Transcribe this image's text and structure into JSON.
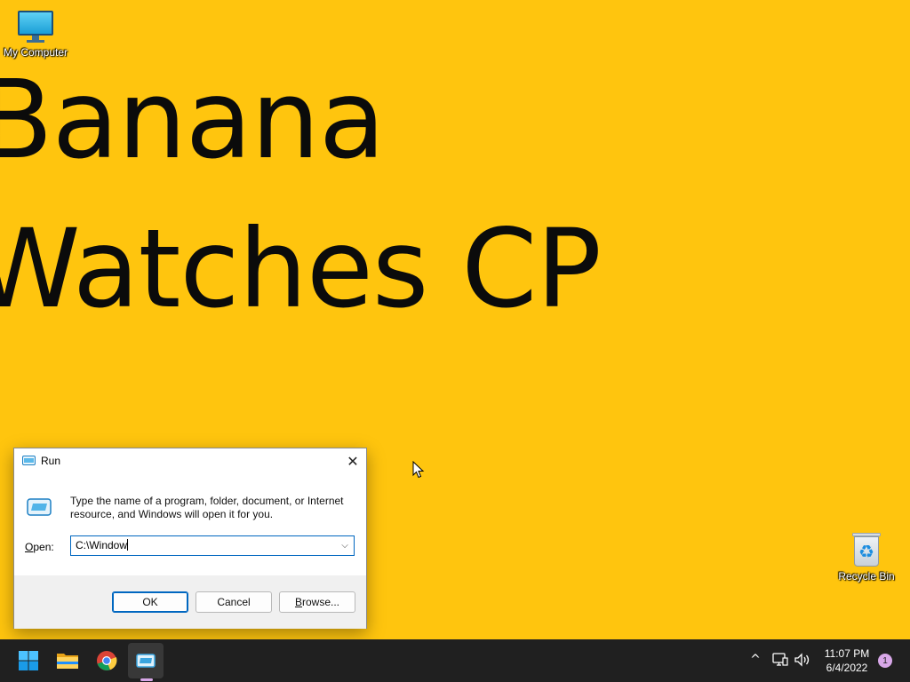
{
  "wallpaper": {
    "line1": "Banana",
    "line2": "Watches CP"
  },
  "desktop_icons": [
    {
      "label": "My Computer",
      "icon": "monitor-icon"
    },
    {
      "label": "Recycle Bin",
      "icon": "recycle-bin-icon"
    }
  ],
  "run_dialog": {
    "title": "Run",
    "description": "Type the name of a program, folder, document, or Internet resource, and Windows will open it for you.",
    "open_label_mnemonic": "O",
    "open_label_rest": "pen:",
    "open_value": "C:\\Window",
    "buttons": {
      "ok": "OK",
      "cancel": "Cancel",
      "browse_mnemonic": "B",
      "browse_rest": "rowse..."
    }
  },
  "taskbar": {
    "apps": [
      {
        "name": "Start",
        "icon": "windows-start-icon"
      },
      {
        "name": "File Explorer",
        "icon": "folder-icon"
      },
      {
        "name": "Google Chrome",
        "icon": "chrome-icon"
      },
      {
        "name": "Run",
        "icon": "run-icon",
        "active": true
      }
    ],
    "tray": {
      "chevron": "^",
      "time": "11:07 PM",
      "date": "6/4/2022",
      "notification_count": "1"
    }
  },
  "colors": {
    "desktop_background": "#FFC50E",
    "taskbar": "#202020",
    "accent": "#0067c0",
    "indicator": "#d8a7e8"
  }
}
